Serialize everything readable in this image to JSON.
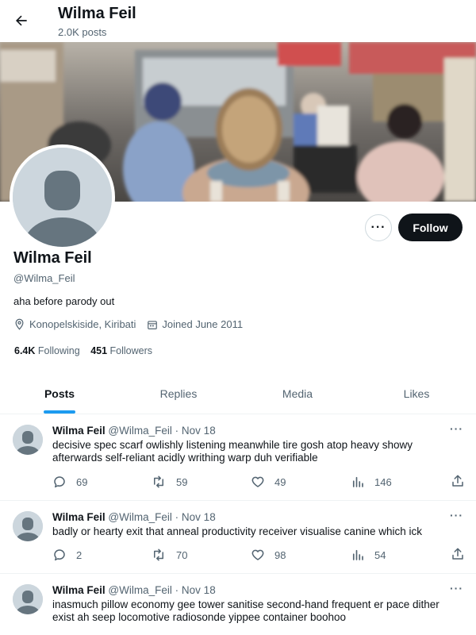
{
  "header": {
    "name": "Wilma Feil",
    "posts_count": "2.0K posts"
  },
  "profile": {
    "name": "Wilma Feil",
    "handle": "@Wilma_Feil",
    "bio": "aha before parody out",
    "location": "Konopelskiside, Kiribati",
    "joined": "Joined June 2011",
    "following_count": "6.4K",
    "following_label": "Following",
    "followers_count": "451",
    "followers_label": "Followers",
    "follow_label": "Follow",
    "more_label": "···"
  },
  "tabs": [
    {
      "label": "Posts",
      "active": true
    },
    {
      "label": "Replies",
      "active": false
    },
    {
      "label": "Media",
      "active": false
    },
    {
      "label": "Likes",
      "active": false
    }
  ],
  "tweets": [
    {
      "name": "Wilma Feil",
      "handle": "@Wilma_Feil",
      "sep": "·",
      "date": "Nov 18",
      "text": "decisive spec scarf owlishly listening meanwhile tire gosh atop heavy showy afterwards self-reliant acidly writhing warp duh verifiable",
      "replies": "69",
      "reposts": "59",
      "likes": "49",
      "views": "146"
    },
    {
      "name": "Wilma Feil",
      "handle": "@Wilma_Feil",
      "sep": "·",
      "date": "Nov 18",
      "text": "badly or hearty exit that anneal productivity receiver visualise canine which ick",
      "replies": "2",
      "reposts": "70",
      "likes": "98",
      "views": "54"
    },
    {
      "name": "Wilma Feil",
      "handle": "@Wilma_Feil",
      "sep": "·",
      "date": "Nov 18",
      "text": "inasmuch pillow economy gee tower sanitise second-hand frequent er pace dither exist ah seep locomotive radiosonde yippee container boohoo"
    }
  ],
  "tweet_more": "···",
  "colors": {
    "accent": "#1d9bf0",
    "text": "#0f1419",
    "secondary": "#536471",
    "follow_bg": "#0f1419"
  }
}
